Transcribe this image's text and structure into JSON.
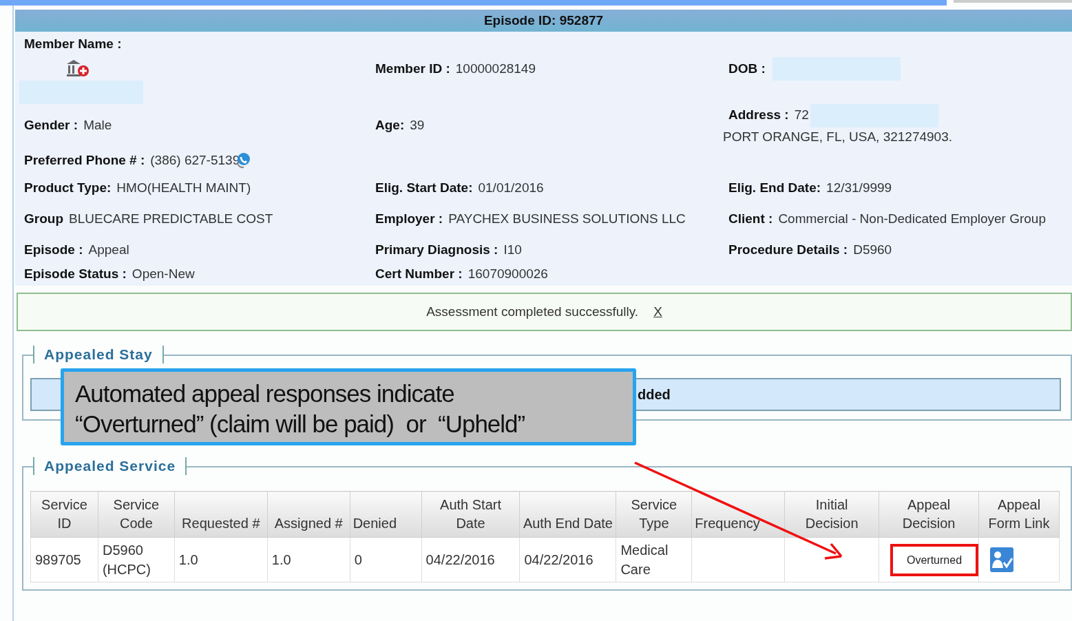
{
  "header": {
    "title": "Episode ID: 952877"
  },
  "member_info": {
    "rows": [
      [
        {
          "kind": "member_name",
          "label": "Member Name :",
          "redacted": true
        },
        {
          "kind": "field",
          "label": "Member ID :",
          "value": "10000028149"
        },
        {
          "kind": "field",
          "label": "DOB :",
          "redacted": true
        }
      ],
      [
        {
          "kind": "field",
          "label": "Gender :",
          "value": "Male"
        },
        {
          "kind": "field",
          "label": "Age:",
          "value": "39"
        },
        {
          "kind": "field",
          "label": "Address :",
          "value": "72",
          "redacted": true,
          "second_line": "PORT ORANGE, FL, USA, 321274903."
        }
      ],
      [
        {
          "kind": "phone",
          "label": "Preferred Phone # :",
          "value": "(386) 627-5139"
        }
      ],
      [
        {
          "kind": "field",
          "label": "Product Type:",
          "value": "HMO(HEALTH MAINT)"
        },
        {
          "kind": "field",
          "label": "Elig. Start Date:",
          "value": "01/01/2016"
        },
        {
          "kind": "field",
          "label": "Elig. End Date:",
          "value": "12/31/9999"
        }
      ],
      [
        {
          "kind": "field",
          "label": "Group",
          "value": "BLUECARE PREDICTABLE COST"
        },
        {
          "kind": "field",
          "label": "Employer :",
          "value": "PAYCHEX BUSINESS SOLUTIONS LLC"
        },
        {
          "kind": "field",
          "label": "Client :",
          "value": "Commercial - Non-Dedicated Employer Group"
        }
      ],
      [
        {
          "kind": "field",
          "label": "Episode :",
          "value": "Appeal"
        },
        {
          "kind": "field",
          "label": "Primary Diagnosis :",
          "value": "I10"
        },
        {
          "kind": "field",
          "label": "Procedure Details :",
          "value": "D5960"
        }
      ],
      [
        {
          "kind": "field",
          "label": "Episode Status :",
          "value": "Open-New"
        },
        {
          "kind": "field",
          "label": "Cert Number :",
          "value": "16070900026"
        }
      ]
    ]
  },
  "alert": {
    "message": "Assessment completed successfully.",
    "close": "X"
  },
  "appealed_stay": {
    "legend": "Appealed Stay",
    "message": "dded"
  },
  "callout": {
    "text": "Automated appeal responses indicate “Overturned” (claim will be paid)  or  “Upheld”"
  },
  "appealed_service": {
    "legend": "Appealed Service",
    "columns": [
      "Service ID",
      "Service Code",
      "Requested #",
      "Assigned #",
      "Denied",
      "Auth Start Date",
      "Auth End Date",
      "Service Type",
      "Frequency",
      "Initial Decision",
      "Appeal Decision",
      "Appeal Form Link"
    ],
    "rows": [
      {
        "cells": [
          "989705",
          "D5960 (HCPC)",
          "1.0",
          "1.0",
          "0",
          "04/22/2016",
          "04/22/2016",
          "Medical Care",
          null,
          null,
          "Overturned",
          null
        ],
        "decision_highlighted": true,
        "form_link": true
      }
    ]
  }
}
